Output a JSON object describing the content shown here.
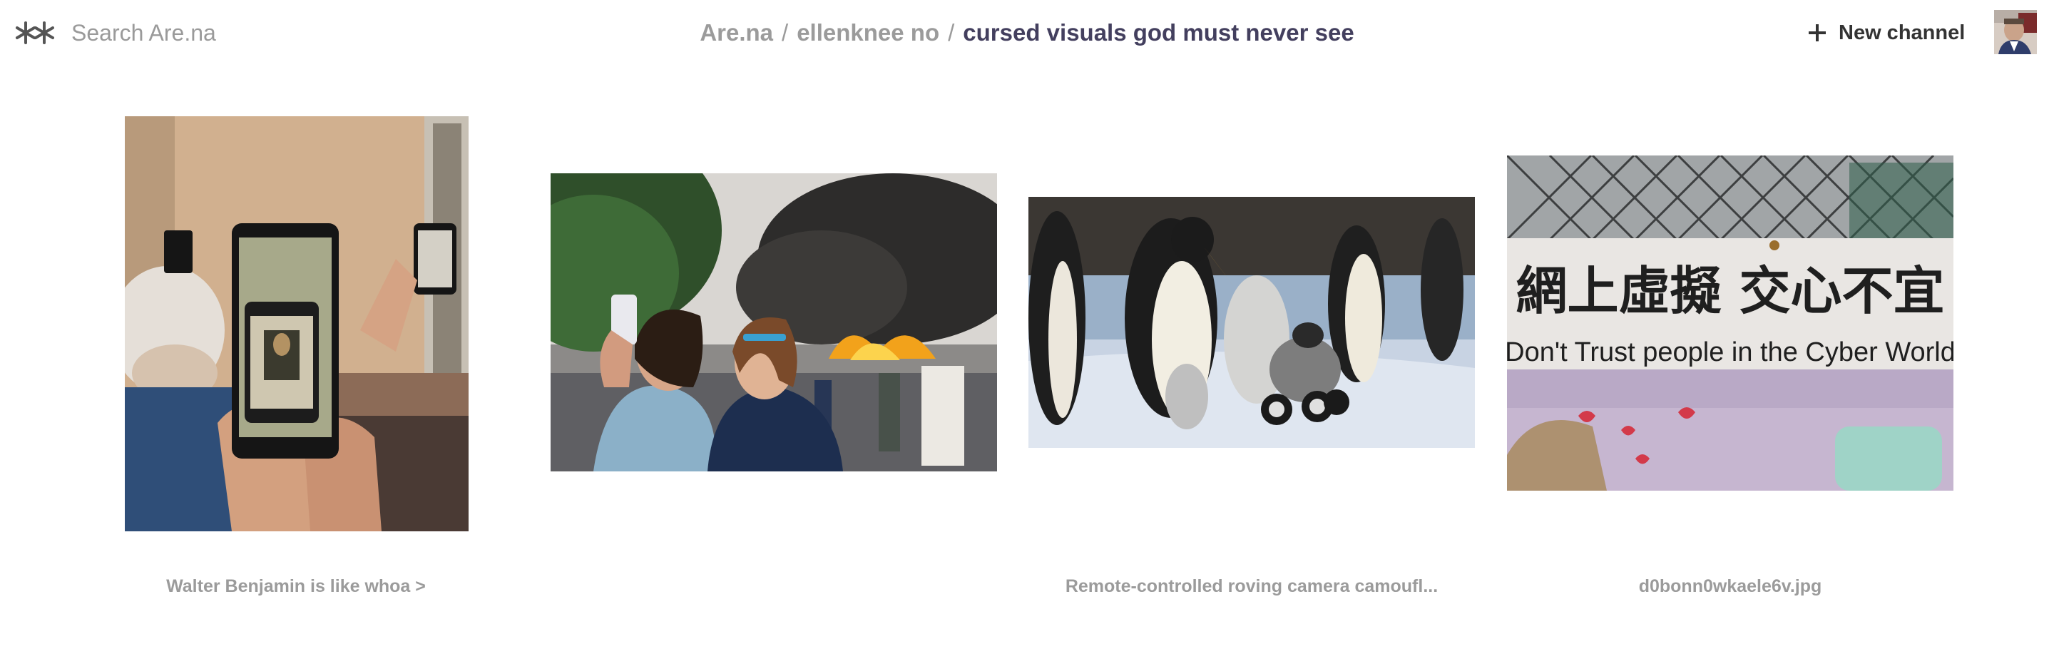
{
  "header": {
    "logo_icon": "are-na-asterisk-logo-icon",
    "search": {
      "placeholder": "Search Are.na",
      "value": ""
    },
    "breadcrumb": {
      "root": "Are.na",
      "separator": "/",
      "user": "ellenknee no",
      "channel": "cursed visuals god must never see"
    },
    "new_channel": {
      "icon": "plus-icon",
      "label": "New channel"
    },
    "avatar_icon": "user-avatar"
  },
  "colors": {
    "channel_title": "#433f5e",
    "muted_text": "#9b9b9b",
    "primary_text": "#333333",
    "background": "#ffffff"
  },
  "blocks": [
    {
      "image": "hands holding phones photographing the Mona Lisa",
      "caption": "Walter Benjamin is like whoa >"
    },
    {
      "image": "two women taking a selfie in front of a burning street",
      "caption": ""
    },
    {
      "image": "emperor penguins with a robotic camera chick on wheels",
      "caption": "Remote-controlled roving camera camoufl..."
    },
    {
      "image": "sign reading Don't Trust people in the Cyber World",
      "caption": "d0bonn0wkaele6v.jpg",
      "sign_text_cn": "網上虛擬 交心不宜",
      "sign_text_en": "Don't Trust people in the Cyber World"
    }
  ]
}
